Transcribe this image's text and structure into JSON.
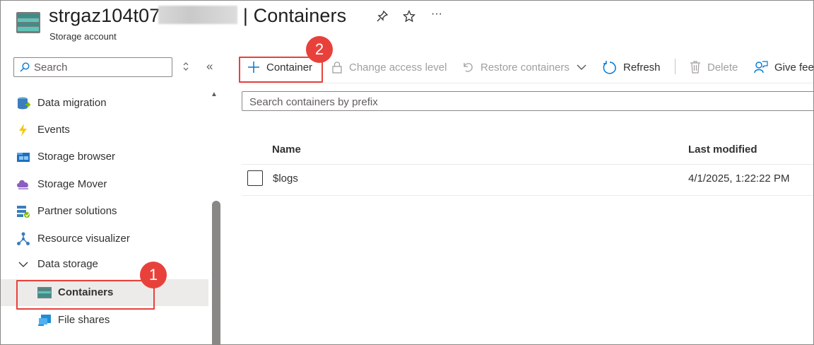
{
  "header": {
    "title_prefix": "strgaz104t07",
    "title_suffix": "| Containers",
    "subtitle": "Storage account",
    "pin_icon": "pin-icon",
    "favorite_icon": "star-icon",
    "more_label": "···"
  },
  "sidebar": {
    "search_placeholder": "Search",
    "expand_icon": "chevron-updown-icon",
    "collapse_label": "«",
    "items": [
      {
        "label": "Data migration",
        "icon": "data-migration-icon"
      },
      {
        "label": "Events",
        "icon": "lightning-icon"
      },
      {
        "label": "Storage browser",
        "icon": "storage-browser-icon"
      },
      {
        "label": "Storage Mover",
        "icon": "storage-mover-icon"
      },
      {
        "label": "Partner solutions",
        "icon": "partner-solutions-icon"
      },
      {
        "label": "Resource visualizer",
        "icon": "resource-visualizer-icon"
      },
      {
        "label": "Data storage",
        "icon": "chevron-down-icon"
      },
      {
        "label": "Containers",
        "icon": "containers-icon",
        "selected": true
      },
      {
        "label": "File shares",
        "icon": "file-shares-icon"
      }
    ]
  },
  "toolbar": {
    "add_container": "Container",
    "change_access": "Change access level",
    "restore": "Restore containers",
    "refresh": "Refresh",
    "delete": "Delete",
    "feedback": "Give fee"
  },
  "filter": {
    "placeholder": "Search containers by prefix"
  },
  "table": {
    "columns": [
      "Name",
      "Last modified"
    ],
    "rows": [
      {
        "name": "$logs",
        "last_modified": "4/1/2025, 1:22:22 PM"
      }
    ]
  },
  "callouts": [
    {
      "number": "1",
      "target": "Containers"
    },
    {
      "number": "2",
      "target": "Container"
    }
  ],
  "colors": {
    "accent": "#0078d4",
    "callout": "#e8413b",
    "selected_bg": "#edebe9",
    "disabled_text": "#a19f9d"
  }
}
